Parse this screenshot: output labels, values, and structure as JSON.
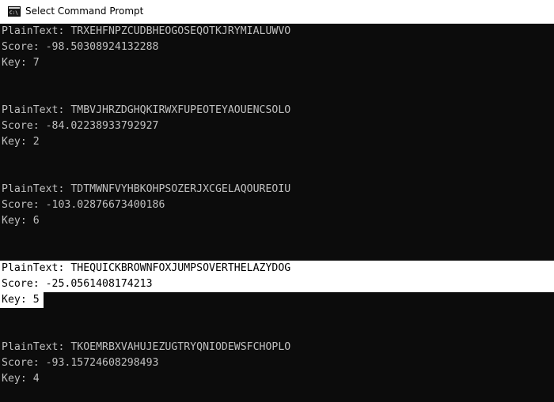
{
  "window": {
    "title": "Select Command Prompt",
    "icon": "cmd-icon",
    "colors": {
      "console_bg": "#0c0c0c",
      "console_fg": "#c0c0c0",
      "selection_bg": "#ffffff",
      "selection_fg": "#000000",
      "titlebar_bg": "#ffffff"
    }
  },
  "console": {
    "lines": [
      "PlainText: TRXEHFNPZCUDBHEOGOSEQOTKJRYMIALUWVO",
      "Score: -98.50308924132288",
      "Key: 7",
      "",
      "",
      "PlainText: TMBVJHRZDGHQKIRWXFUPEOTEYAOUENCSOLO",
      "Score: -84.02238933792927",
      "Key: 2",
      "",
      "",
      "PlainText: TDTMWNFVYHBKOHPSOZERJXCGELAQOUREOIU",
      "Score: -103.02876673400186",
      "Key: 6",
      "",
      "",
      "PlainText: THEQUICKBROWNFOXJUMPSOVERTHELAZYDOG",
      "Score: -25.0561408174213",
      "Key: 5",
      "",
      "",
      "PlainText: TKOEMRBXVAHUJEZUGTRYQNIODEWSFCHOPLO",
      "Score: -93.15724608298493",
      "Key: 4"
    ]
  }
}
